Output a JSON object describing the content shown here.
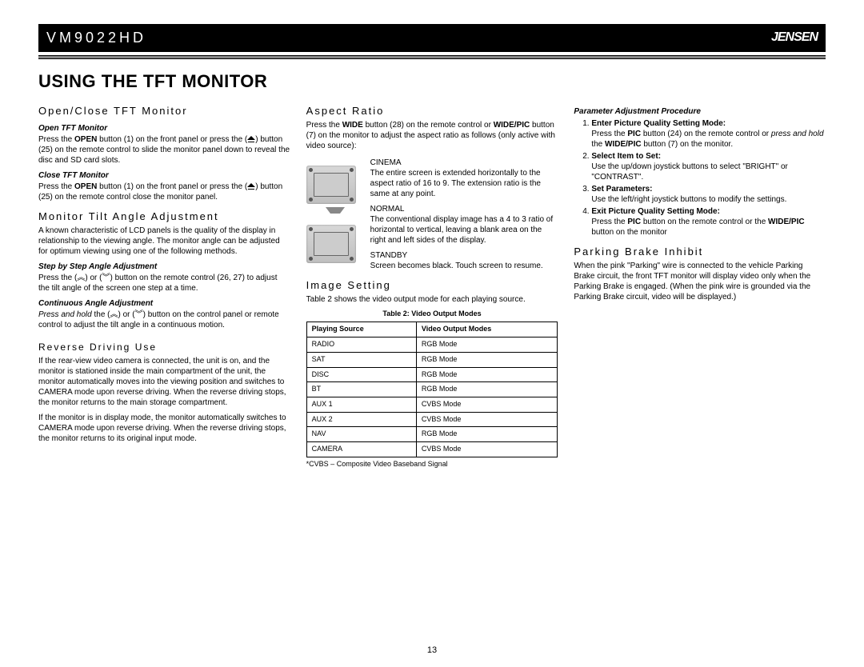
{
  "header": {
    "model": "VM9022HD",
    "brand": "JENSEN"
  },
  "title": "USING THE TFT MONITOR",
  "col1": {
    "s1_h": "Open/Close TFT Monitor",
    "s1a_h": "Open TFT Monitor",
    "s1a_p": "Press the OPEN button (1) on the front panel or press the ( ) button (25) on the remote control to slide the monitor panel down to reveal the disc and SD card slots.",
    "s1b_h": "Close TFT Monitor",
    "s1b_p": "Press the OPEN button (1) on the front panel or press the ( ) button (25) on the remote control close the monitor panel.",
    "s2_h": "Monitor Tilt Angle Adjustment",
    "s2_p": "A known characteristic of LCD panels is the quality of the display in relationship to the viewing angle. The monitor angle can be adjusted for optimum viewing using one of the following methods.",
    "s2a_h": "Step by Step Angle Adjustment",
    "s2a_p": "Press the ( ) or ( ) button on the remote control (26, 27) to adjust the tilt angle of the screen one step at a time.",
    "s2b_h": "Continuous Angle Adjustment",
    "s2b_p_pre": "Press and hold",
    "s2b_p": " the ( ) or ( ) button on the control panel or remote control to adjust the tilt angle in a continuous motion.",
    "s3_h": "Reverse Driving Use",
    "s3_p1": "If the rear-view video camera is connected, the unit is on, and the monitor is stationed inside the main compartment of the unit, the monitor automatically moves into the viewing position and switches to CAMERA mode upon reverse driving. When the reverse driving stops, the monitor returns to the main storage compartment.",
    "s3_p2": "If the monitor is in display mode, the monitor automatically switches to CAMERA mode upon reverse driving. When the reverse driving stops, the monitor returns to its original input mode."
  },
  "col2": {
    "s1_h": "Aspect Ratio",
    "s1_p": "Press the WIDE button (28) on the remote control or WIDE/PIC button (7) on the monitor to adjust the aspect ratio as follows (only active with video source):",
    "cinema_h": "CINEMA",
    "cinema_p": "The entire screen is extended horizontally to the aspect ratio of 16 to 9. The extension ratio is the same at any point.",
    "normal_h": "NORMAL",
    "normal_p": "The conventional display image has a 4 to 3 ratio of horizontal to vertical, leaving a blank area on the right and left sides of the display.",
    "standby_h": "STANDBY",
    "standby_p": "Screen becomes black. Touch screen to resume.",
    "s2_h": "Image Setting",
    "s2_p": "Table 2 shows the video output mode for each playing source.",
    "table_caption": "Table 2: Video Output Modes",
    "th1": "Playing Source",
    "th2": "Video Output Modes",
    "rows": [
      {
        "s": "RADIO",
        "m": "RGB Mode"
      },
      {
        "s": "SAT",
        "m": "RGB Mode"
      },
      {
        "s": "DISC",
        "m": "RGB Mode"
      },
      {
        "s": "BT",
        "m": "RGB Mode"
      },
      {
        "s": "AUX 1",
        "m": "CVBS Mode"
      },
      {
        "s": "AUX 2",
        "m": "CVBS Mode"
      },
      {
        "s": "NAV",
        "m": "RGB Mode"
      },
      {
        "s": "CAMERA",
        "m": "CVBS Mode"
      }
    ],
    "footnote": "*CVBS – Composite Video Baseband Signal"
  },
  "col3": {
    "s1_h": "Parameter Adjustment Procedure",
    "li1_b": "Enter Picture Quality Setting Mode:",
    "li1_p_a": "Press the PIC button (24) on the remote control or ",
    "li1_p_i": "press and hold",
    "li1_p_b": " the WIDE/PIC button (7) on the monitor.",
    "li2_b": "Select Item to Set:",
    "li2_p": "Use the up/down joystick buttons to select \"BRIGHT\" or \"CONTRAST\".",
    "li3_b": "Set Parameters:",
    "li3_p": "Use the left/right joystick buttons to modify the settings.",
    "li4_b": "Exit Picture Quality Setting Mode:",
    "li4_p": "Press the PIC button on the remote control or the WIDE/PIC button on the monitor",
    "s2_h": "Parking Brake Inhibit",
    "s2_p": "When the pink \"Parking\" wire is connected to the vehicle Parking Brake circuit, the front TFT monitor will display video only when the Parking Brake is engaged. (When the pink wire is grounded via the Parking Brake circuit, video will be displayed.)"
  },
  "page_num": "13"
}
